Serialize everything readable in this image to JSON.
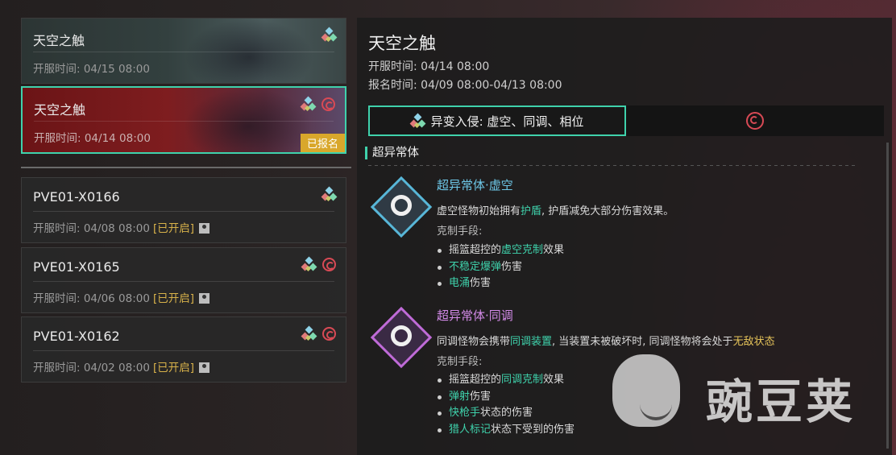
{
  "list": {
    "seasons": [
      {
        "title": "天空之触",
        "time": "开服时间: 04/15 08:00"
      },
      {
        "title": "天空之触",
        "time": "开服时间: 04/14 08:00",
        "badge": "已报名"
      }
    ],
    "servers": [
      {
        "title": "PVE01-X0166",
        "time": "开服时间: 04/08 08:00",
        "tag": "[已开启]"
      },
      {
        "title": "PVE01-X0165",
        "time": "开服时间: 04/06 08:00",
        "tag": "[已开启]"
      },
      {
        "title": "PVE01-X0162",
        "time": "开服时间: 04/02 08:00",
        "tag": "[已开启]"
      }
    ]
  },
  "detail": {
    "title": "天空之触",
    "open_time": "开服时间: 04/14 08:00",
    "register_time": "报名时间: 04/09 08:00-04/13 08:00",
    "tab1_label": "异变入侵: 虚空、同调、相位",
    "section_heading": "超异常体",
    "entries": [
      {
        "name": "超异常体·虚空",
        "desc_pre": "虚空怪物初始拥有",
        "desc_hl": "护盾",
        "desc_post": ", 护盾减免大部分伤害效果。",
        "counter_label": "克制手段:",
        "b1_pre": "摇篮超控的",
        "b1_hl": "虚空克制",
        "b1_post": "效果",
        "b2_hl": "不稳定爆弹",
        "b2_post": "伤害",
        "b3_hl": "电涌",
        "b3_post": "伤害"
      },
      {
        "name": "超异常体·同调",
        "desc_pre": "同调怪物会携带",
        "desc_hl": "同调装置",
        "desc_mid": ", 当装置未被破坏时, 同调怪物将会处于",
        "desc_hl2": "无敌状态",
        "counter_label": "克制手段:",
        "b1_pre": "摇篮超控的",
        "b1_hl": "同调克制",
        "b1_post": "效果",
        "b2_hl": "弹射",
        "b2_post": "伤害",
        "b3_hl": "快枪手",
        "b3_post": "状态的伤害",
        "b4_hl": "猎人标记",
        "b4_post": "状态下受到的伤害"
      }
    ]
  },
  "watermark": {
    "text": "豌豆荚"
  },
  "icons": [
    "crystal-icon",
    "red-glyph-icon",
    "lock-icon"
  ],
  "colors": {
    "accent": "#3fd2ac",
    "tag": "#d8b24a",
    "badge": "#d9a72b",
    "void": "#6ec8e8",
    "sync": "#d38be8"
  }
}
